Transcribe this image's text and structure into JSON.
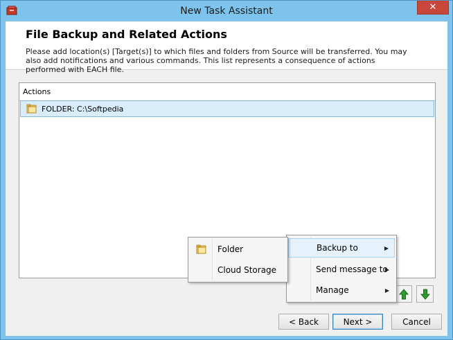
{
  "window": {
    "title": "New Task Assistant",
    "close_glyph": "✕"
  },
  "header": {
    "title": "File Backup and Related Actions",
    "description": "Please add location(s) [Target(s)] to which files and folders from Source will be transferred. You may also add notifications and various commands. This list represents a consequence of actions performed with EACH file."
  },
  "actions": {
    "header": "Actions",
    "rows": [
      {
        "label": "FOLDER: C:\\Softpedia",
        "icon": "folder-icon"
      }
    ]
  },
  "context_menu": {
    "items": [
      {
        "label": "Backup to",
        "has_submenu": true,
        "highlighted": true
      },
      {
        "label": "Send message to",
        "has_submenu": true
      },
      {
        "label": "Manage",
        "has_submenu": true
      }
    ],
    "submenu_arrow": "▶"
  },
  "submenu": {
    "items": [
      {
        "label": "Folder",
        "icon": "folder-icon"
      },
      {
        "label": "Cloud Storage"
      }
    ]
  },
  "buttons": {
    "back": "< Back",
    "next": "Next >",
    "cancel": "Cancel"
  },
  "colors": {
    "accent": "#7ec3ec",
    "close": "#c7473b",
    "arrow_green": "#2f9a2f"
  }
}
